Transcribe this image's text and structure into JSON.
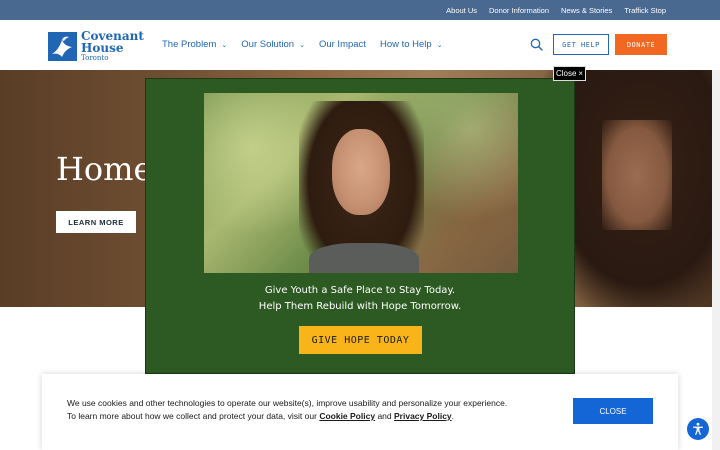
{
  "utility_nav": {
    "items": [
      "About Us",
      "Donor Information",
      "News & Stories",
      "Traffick Stop"
    ]
  },
  "logo": {
    "line1": "Covenant",
    "line2": "House",
    "line3": "Toronto"
  },
  "main_nav": {
    "items": [
      {
        "label": "The Problem",
        "has_dropdown": true
      },
      {
        "label": "Our Solution",
        "has_dropdown": true
      },
      {
        "label": "Our Impact",
        "has_dropdown": false
      },
      {
        "label": "How to Help",
        "has_dropdown": true
      }
    ]
  },
  "header_actions": {
    "get_help": "GET HELP",
    "donate": "DONATE"
  },
  "hero": {
    "heading": "Home",
    "button": "LEARN MORE"
  },
  "modal": {
    "close_label": "Close",
    "close_glyph": "×",
    "line1": "Give Youth a Safe Place to Stay Today.",
    "line2": "Help Them Rebuild with Hope Tomorrow.",
    "cta": "GIVE HOPE TODAY"
  },
  "cookie_banner": {
    "text1": "We use cookies and other technologies to operate our website(s), improve usability and personalize your experience.",
    "text2": "To learn more about how we collect and protect your data, visit our",
    "cookie_policy": "Cookie Policy",
    "and": "and",
    "privacy_policy": "Privacy Policy",
    "period": ".",
    "close": "CLOSE"
  },
  "colors": {
    "utility_bar": "#4a6991",
    "brand_blue": "#1f67b5",
    "donate_orange": "#f26722",
    "modal_green": "#2d5a23",
    "cta_yellow": "#f8b418",
    "cookie_blue": "#1466d6"
  },
  "icons": [
    "dove-logo-icon",
    "chevron-down-icon",
    "search-icon",
    "close-icon",
    "accessibility-icon"
  ]
}
